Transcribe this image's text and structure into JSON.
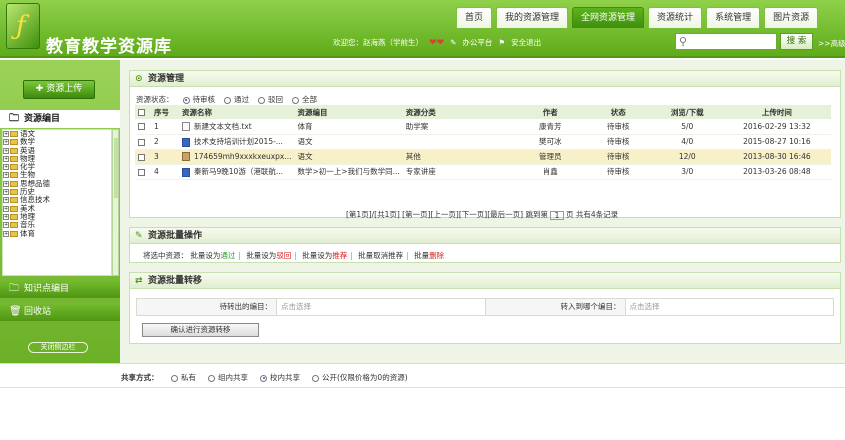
{
  "header": {
    "logo_letter": "ƒ",
    "title": "教育教学资源库",
    "tabs": [
      "首页",
      "我的资源管理",
      "全网资源管理",
      "资源统计",
      "系统管理",
      "图片资源"
    ],
    "active_tab": 2,
    "welcome": "欢迎您：赵海燕（学前生）",
    "office_link": "办公平台",
    "logout_link": "安全退出",
    "search_button": "搜 索",
    "advanced_link": ">>高级"
  },
  "sidebar": {
    "upload_button": "资源上传",
    "section_resources": "资源编目",
    "tree_items": [
      "语文",
      "数学",
      "英语",
      "物理",
      "化学",
      "生物",
      "思想品德",
      "历史",
      "信息技术",
      "美术",
      "地理",
      "音乐",
      "体育"
    ],
    "section_knowledge": "知识点编目",
    "section_recycle": "回收站",
    "bottom_link": "关闭侧边栏"
  },
  "resource_panel": {
    "title": "资源管理",
    "status_label": "资源状态：",
    "status_options": [
      "待审核",
      "通过",
      "驳回",
      "全部"
    ],
    "status_selected": 0,
    "columns": [
      "序号",
      "资源名称",
      "资源编目",
      "资源分类",
      "作者",
      "状态",
      "浏览/下载",
      "上传时间"
    ],
    "rows": [
      {
        "no": "1",
        "name": "新建文本文档.txt",
        "catalog": "体育",
        "category": "助学案",
        "author": "康青芳",
        "status": "待审核",
        "views": "5/0",
        "time": "2016-02-29 13:32",
        "icon": "txt"
      },
      {
        "no": "2",
        "name": "技术支持培训计划2015-...",
        "catalog": "语文",
        "category": "",
        "author": "樊可冰",
        "status": "待审核",
        "views": "4/0",
        "time": "2015-08-27 10:16",
        "icon": "word"
      },
      {
        "no": "3",
        "name": "174659mh9xxxkxeuxpx...",
        "catalog": "语文",
        "category": "其他",
        "author": "管理员",
        "status": "待审核",
        "views": "12/0",
        "time": "2013-08-30 16:46",
        "icon": "img"
      },
      {
        "no": "4",
        "name": "秦新马9晚10游（港联航...",
        "catalog": "数学>初一上>我们与数学同...",
        "category": "专家讲座",
        "author": "肖鑫",
        "status": "待审核",
        "views": "3/0",
        "time": "2013-03-26 08:48",
        "icon": "word"
      }
    ],
    "highlight_row": 2,
    "pager": "[第1页]/[共1页] [第一页][上一页][下一页][最后一页] 跳到第",
    "pager_input": "1",
    "pager_suffix": "页 共有4条记录"
  },
  "batch_panel": {
    "title": "资源批量操作",
    "label": "将选中资源：",
    "a1_pre": "批量设为",
    "a1_em": "通过",
    "a2_pre": "批量设为",
    "a2_em": "驳回",
    "a3_pre": "批量设为",
    "a3_em": "推荐",
    "a4": "批量取消推荐",
    "a5_pre": "批量",
    "a5_em": "删除"
  },
  "move_panel": {
    "title": "资源批量转移",
    "from_label": "待转出的编目：",
    "from_placeholder": "点击选择",
    "to_label": "转入到哪个编目：",
    "to_placeholder": "点击选择",
    "confirm_button": "确认进行资源转移"
  },
  "share": {
    "label": "共享方式：",
    "options": [
      "私有",
      "组内共享",
      "校内共享",
      "公开(仅限价格为0的资源)"
    ],
    "selected": 2
  },
  "colors": {
    "accent": "#5fab1a",
    "highlight": "#f8f0c8",
    "approve": "#2e9a2e",
    "reject": "#d62020"
  }
}
